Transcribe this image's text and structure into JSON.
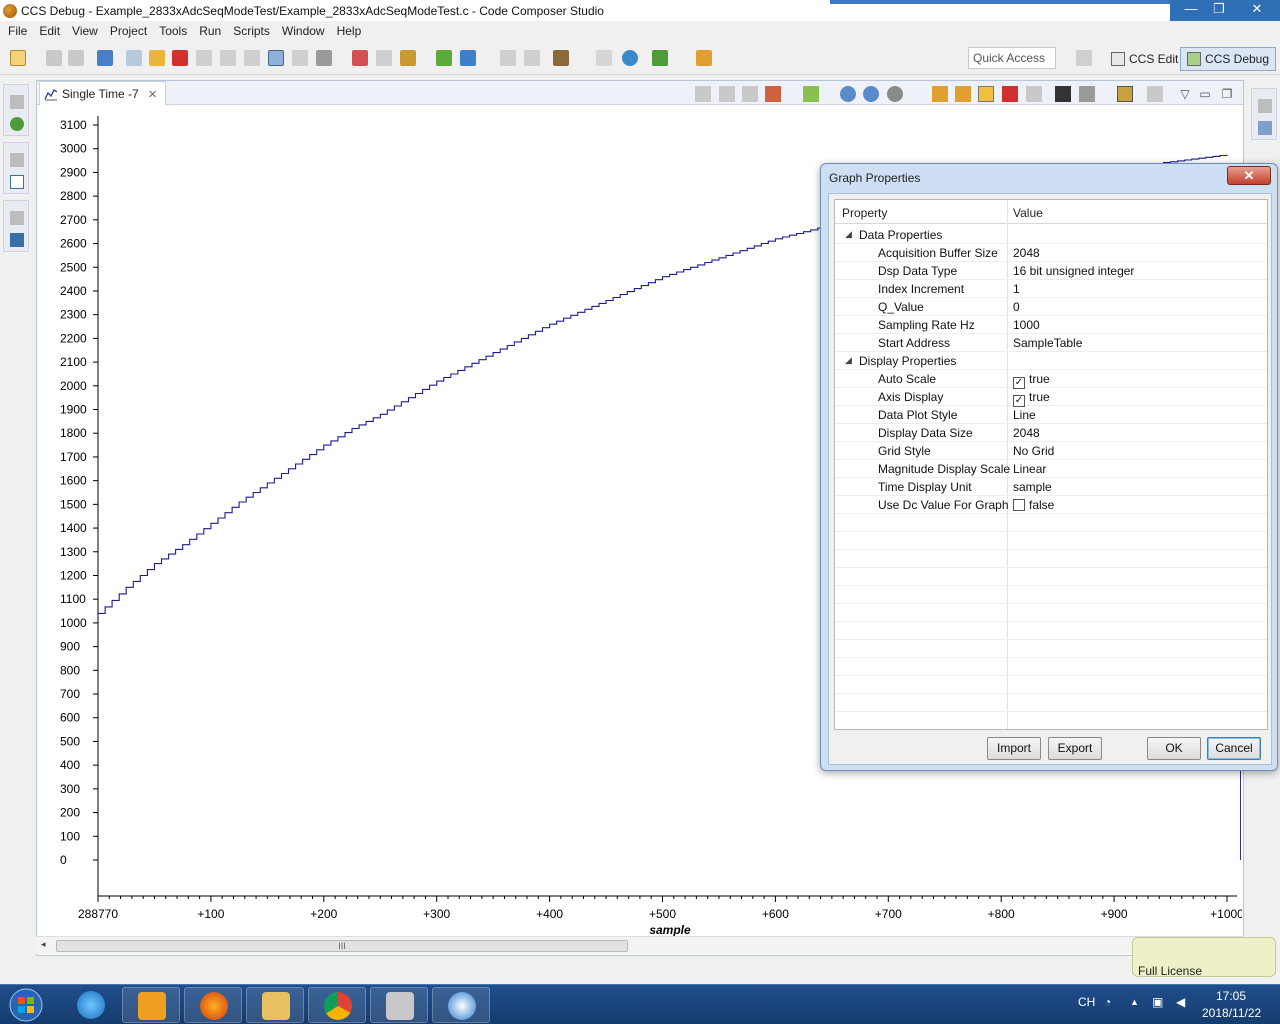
{
  "window": {
    "title": "CCS Debug - Example_2833xAdcSeqModeTest/Example_2833xAdcSeqModeTest.c - Code Composer Studio",
    "caption": {
      "minimize": "—",
      "maximize": "❐",
      "close": "✕"
    }
  },
  "menu": [
    "File",
    "Edit",
    "View",
    "Project",
    "Tools",
    "Run",
    "Scripts",
    "Window",
    "Help"
  ],
  "toolbar": {
    "quick_access_placeholder": "Quick Access",
    "perspectives": [
      {
        "label": "CCS Edit"
      },
      {
        "label": "CCS Debug"
      }
    ]
  },
  "editor": {
    "tab_label": "Single Time -7",
    "tab_close": "✕"
  },
  "chart_data": {
    "type": "line",
    "xlabel": "sample",
    "ylabel": "",
    "title": "",
    "x_tick_labels": [
      "288770",
      "+100",
      "+200",
      "+300",
      "+400",
      "+500",
      "+600",
      "+700",
      "+800",
      "+900",
      "+1000"
    ],
    "y_ticks": [
      0,
      100,
      200,
      300,
      400,
      500,
      600,
      700,
      800,
      900,
      1000,
      1100,
      1200,
      1300,
      1400,
      1500,
      1600,
      1700,
      1800,
      1900,
      2000,
      2100,
      2200,
      2300,
      2400,
      2500,
      2600,
      2700,
      2800,
      2900,
      3000,
      3100
    ],
    "xlim": [
      0,
      1000
    ],
    "ylim": [
      0,
      3100
    ],
    "grid": false,
    "series": [
      {
        "color": "#1c1c8c",
        "x": [
          0,
          25,
          50,
          75,
          100,
          125,
          150,
          175,
          200,
          225,
          250,
          275,
          300,
          325,
          350,
          375,
          400,
          425,
          450,
          475,
          500,
          525,
          550,
          575,
          600,
          625,
          650,
          675,
          700,
          725,
          750,
          775,
          800,
          825,
          850,
          875,
          900,
          925,
          950,
          975,
          1000
        ],
        "y": [
          1040,
          1150,
          1250,
          1330,
          1420,
          1510,
          1590,
          1670,
          1750,
          1820,
          1880,
          1950,
          2020,
          2080,
          2140,
          2200,
          2260,
          2310,
          2360,
          2410,
          2460,
          2500,
          2540,
          2580,
          2620,
          2650,
          2680,
          2710,
          2740,
          2770,
          2800,
          2820,
          2840,
          2860,
          2880,
          2900,
          2915,
          2930,
          2945,
          2960,
          2975
        ]
      }
    ]
  },
  "scrollbar": {
    "grip": "III",
    "left_arrow": "◂"
  },
  "dialog": {
    "title": "Graph Properties",
    "close": "✕",
    "col_property": "Property",
    "col_value": "Value",
    "groups": [
      {
        "label": "Data Properties",
        "twisty": "◢",
        "rows": [
          {
            "name": "Acquisition Buffer Size",
            "value": "2048"
          },
          {
            "name": "Dsp Data Type",
            "value": "16 bit unsigned integer"
          },
          {
            "name": "Index Increment",
            "value": "1"
          },
          {
            "name": "Q_Value",
            "value": "0"
          },
          {
            "name": "Sampling Rate Hz",
            "value": "1000"
          },
          {
            "name": "Start Address",
            "value": "SampleTable"
          }
        ]
      },
      {
        "label": "Display Properties",
        "twisty": "◢",
        "rows": [
          {
            "name": "Auto Scale",
            "value": "true",
            "checkbox": true,
            "checked": true
          },
          {
            "name": "Axis Display",
            "value": "true",
            "checkbox": true,
            "checked": true
          },
          {
            "name": "Data Plot Style",
            "value": "Line"
          },
          {
            "name": "Display Data Size",
            "value": "2048"
          },
          {
            "name": "Grid Style",
            "value": "No Grid"
          },
          {
            "name": "Magnitude Display Scale",
            "value": "Linear"
          },
          {
            "name": "Time Display Unit",
            "value": "sample"
          },
          {
            "name": "Use Dc Value For Graph",
            "value": "false",
            "checkbox": true,
            "checked": false
          }
        ]
      }
    ],
    "buttons": {
      "import": "Import",
      "export": "Export",
      "ok": "OK",
      "cancel": "Cancel"
    }
  },
  "status": {
    "license": "Full License"
  },
  "taskbar": {
    "apps": [
      "internet-explorer",
      "outlook",
      "firefox",
      "file-explorer",
      "chrome",
      "virtualbox",
      "code-composer-studio"
    ],
    "language": "CH",
    "time": "17:05",
    "date": "2018/11/22"
  }
}
